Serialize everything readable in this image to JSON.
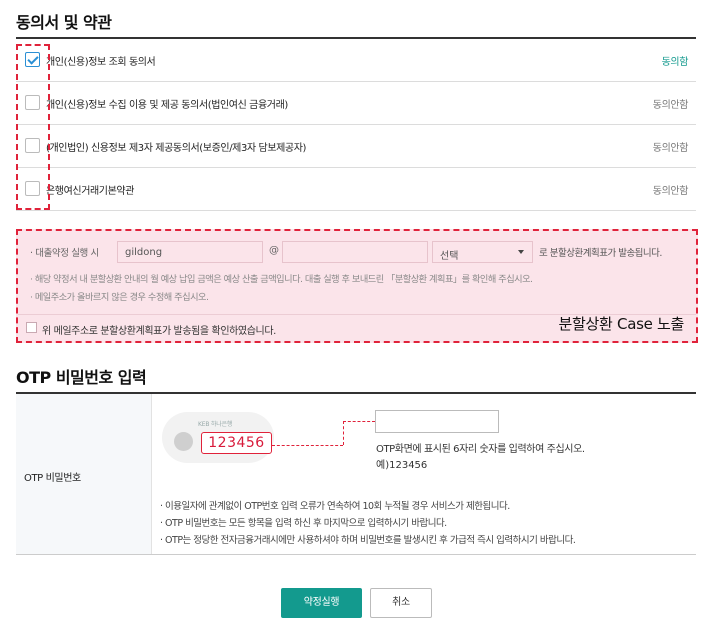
{
  "consent": {
    "title": "동의서 및 약관",
    "items": [
      {
        "label": "개인(신용)정보 조회 동의서",
        "status": "동의함",
        "checked": true
      },
      {
        "label": "개인(신용)정보 수집 이용 및 제공 동의서(법인여신 금융거래)",
        "status": "동의안함",
        "checked": false
      },
      {
        "label": "(개인법인) 신용정보 제3자 제공동의서(보증인/제3자 담보제공자)",
        "status": "동의안함",
        "checked": false
      },
      {
        "label": "은행여신거래기본약관",
        "status": "동의안함",
        "checked": false
      }
    ]
  },
  "repayment": {
    "intro": "· 대출약정 실행 시",
    "email_id": "gildong",
    "at_sign": "@",
    "domain_value": "",
    "select_label": "선택",
    "tail": "로 분할상환계획표가 발송됩니다.",
    "notes": [
      "· 해당 약정서 내 분할상환 안내의 월 예상 납입 금액은 예상 산출 금액입니다.  대출 실행 후 보내드린 「분할상환 계획표」를 확인해 주십시오.",
      "· 메일주소가 올바르지 않은 경우 수정해 주십시오."
    ],
    "confirm_label": "위 메일주소로 분할상환계획표가 발송됨을 확인하였습니다.",
    "case_label": "분할상환 Case 노출"
  },
  "otp": {
    "title": "OTP 비밀번호 입력",
    "field_label": "OTP 비밀번호",
    "bank_label": "KEB 하나은행",
    "sample_code": "123456",
    "input_value": "",
    "help": "OTP화면에 표시된 6자리 숫자를 입력하여 주십시오.",
    "example": "예)123456",
    "notes": [
      "· 이용일자에 관계없이 OTP번호 입력 오류가 연속하여 10회 누적될 경우 서비스가 제한됩니다.",
      "· OTP 비밀번호는 모든 항목을 입력 하신 후 마지막으로 입력하시기 바랍니다.",
      "· OTP는 정당한 전자금융거래시에만 사용하셔야 하며 비밀번호를 발생시킨 후 가급적 즉시 입력하시기 바랍니다."
    ]
  },
  "buttons": {
    "submit": "약정실행",
    "cancel": "취소"
  },
  "colors": {
    "accent": "#139a8e",
    "highlight": "#e0223a",
    "pink_bg": "#fbe4ea"
  }
}
